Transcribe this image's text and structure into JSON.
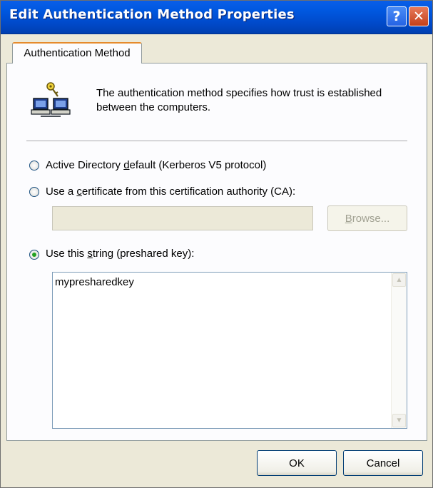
{
  "window": {
    "title": "Edit Authentication Method Properties",
    "help_glyph": "?",
    "close_glyph": "✕",
    "icons": [
      "help-button",
      "close-icon"
    ]
  },
  "tab": {
    "label": "Authentication Method"
  },
  "description": "The authentication method specifies how trust is established between the computers.",
  "options": {
    "kerberos": {
      "pre": "Active Directory ",
      "accel": "d",
      "post": "efault (Kerberos V5 protocol)",
      "selected": false
    },
    "certificate": {
      "pre": "Use a ",
      "accel": "c",
      "post": "ertificate from this certification authority (CA):",
      "selected": false
    },
    "preshared": {
      "pre": "Use this ",
      "accel": "s",
      "post": "tring (preshared key):",
      "selected": true
    }
  },
  "ca_field": {
    "value": "",
    "enabled": false
  },
  "browse_button": {
    "accel": "B",
    "rest": "rowse...",
    "enabled": false
  },
  "preshared_key": {
    "value": "mypresharedkey"
  },
  "footer": {
    "ok": "OK",
    "cancel": "Cancel"
  },
  "colors": {
    "titlebar": "#0058e0",
    "dialog_face": "#ece9d8",
    "tab_highlight": "#e68b2c",
    "radio_dot": "#21a121"
  }
}
